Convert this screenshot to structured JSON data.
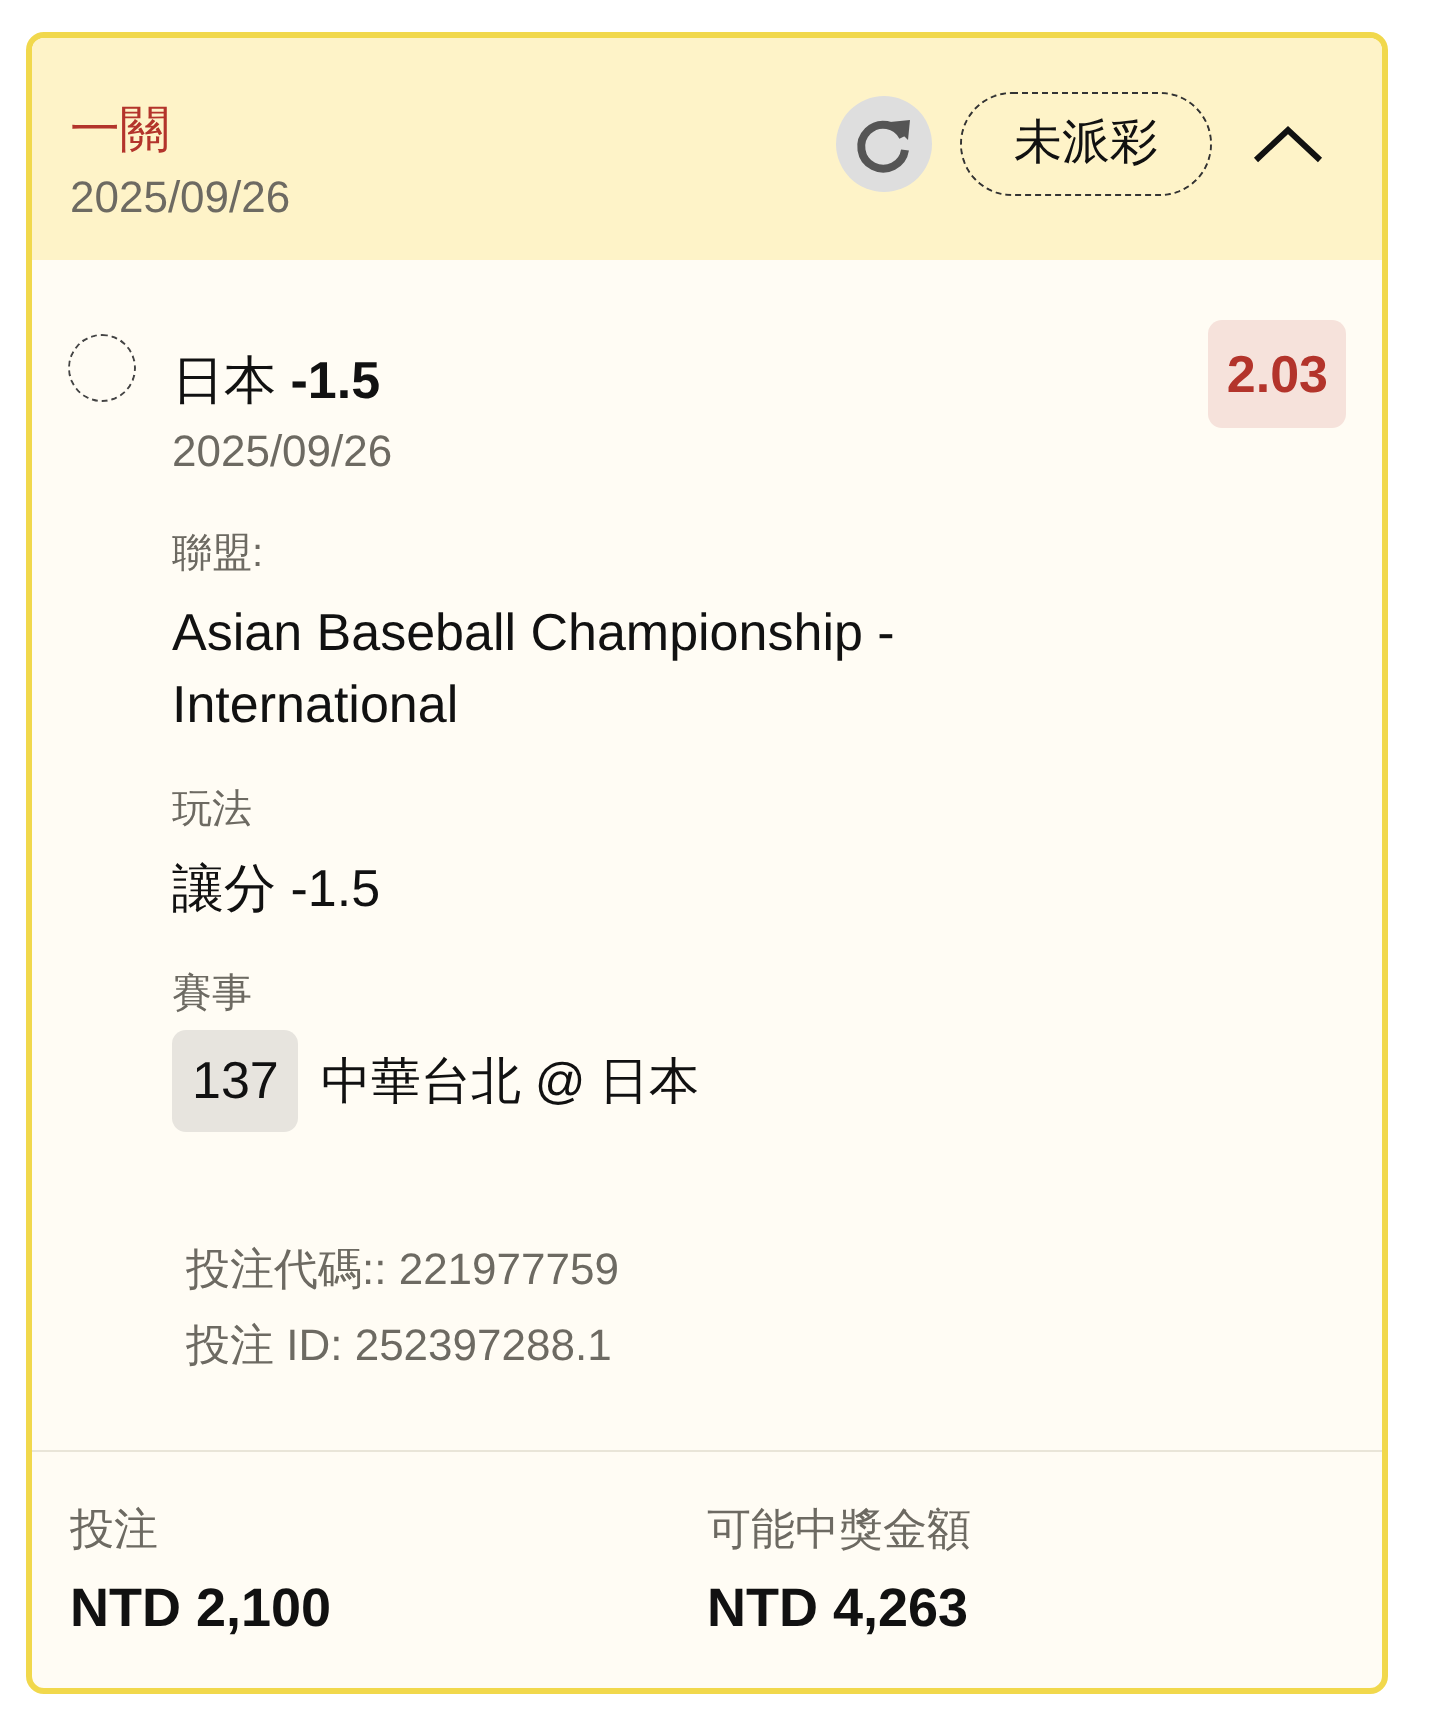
{
  "header": {
    "title": "一關",
    "date": "2025/09/26",
    "status": "未派彩",
    "expanded": true
  },
  "selection": {
    "selected": false,
    "title": "日本 **-1.5**",
    "date": "2025/09/26",
    "odds": "2.03"
  },
  "fields": [
    {
      "kind": "text",
      "label": "聯盟:",
      "value": "Asian Baseball Championship - International"
    },
    {
      "kind": "text",
      "label": "玩法",
      "value": "讓分 -1.5"
    },
    {
      "kind": "match",
      "label": "賽事",
      "number": "137",
      "value": "中華台北 @ 日本"
    }
  ],
  "references": [
    "投注代碼:: 221977759",
    "投注 ID: 252397288.1"
  ],
  "footer": [
    {
      "label": "投注",
      "value": "NTD 2,100"
    },
    {
      "label": "可能中獎金額",
      "value": "NTD 4,263"
    }
  ]
}
